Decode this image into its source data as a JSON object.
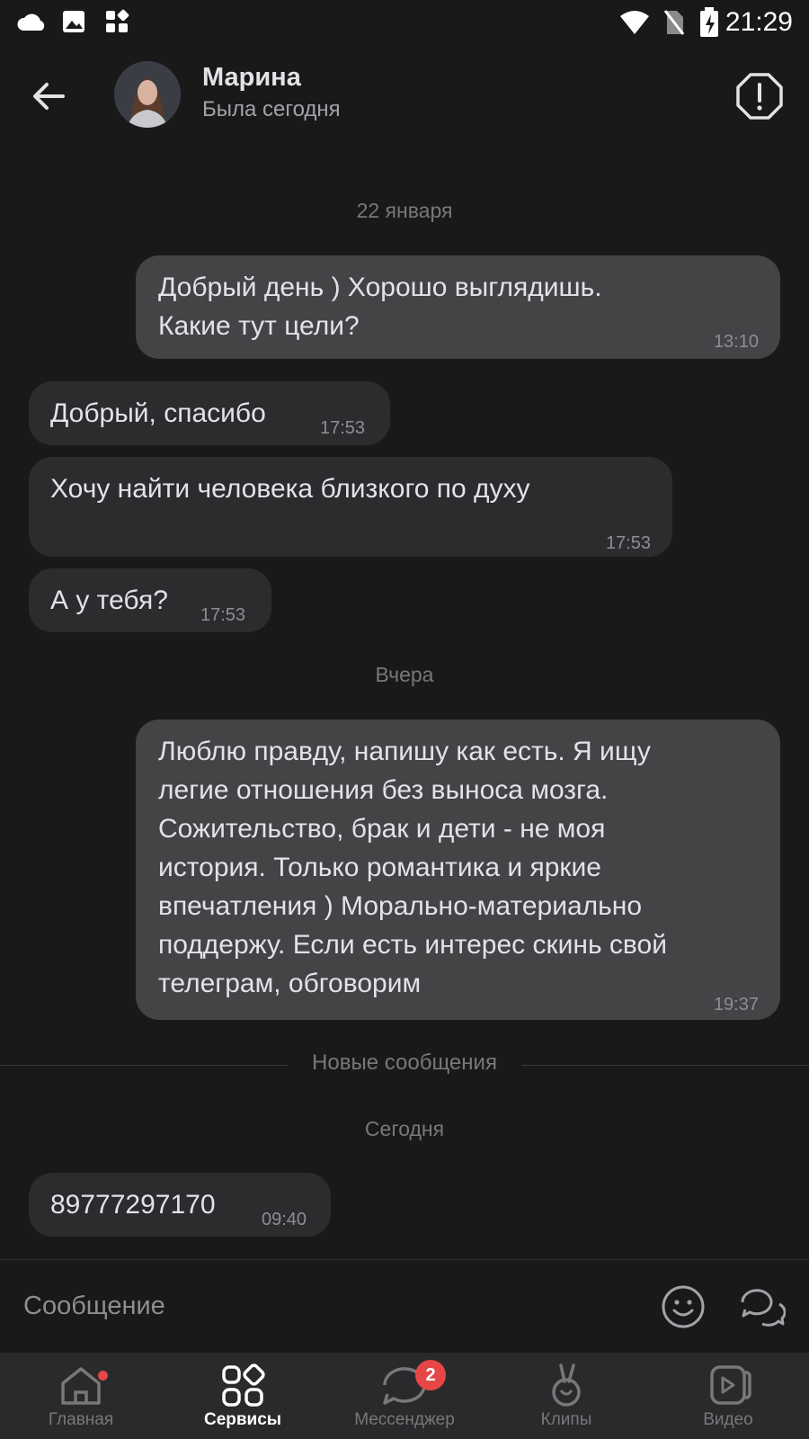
{
  "status_bar": {
    "time": "21:29"
  },
  "header": {
    "contact_name": "Марина",
    "contact_status": "Была сегодня"
  },
  "messages": {
    "date1": "22 января",
    "m1": {
      "lines": [
        "Добрый день ) Хорошо выглядишь.",
        "Какие тут цели?"
      ],
      "time": "13:10"
    },
    "m2": {
      "text": "Добрый, спасибо",
      "time": "17:53"
    },
    "m3": {
      "text": "Хочу найти человека близкого по духу",
      "time": "17:53"
    },
    "m4": {
      "text": "А у тебя?",
      "time": "17:53"
    },
    "date2": "Вчера",
    "m5": {
      "lines": [
        "Люблю правду, напишу как есть. Я ищу",
        "легие отношения без выноса мозга.",
        "Сожительство, брак и дети - не моя",
        "история. Только романтика и яркие",
        "впечатления ) Морально-материально",
        "поддержу. Если есть интерес скинь свой",
        "телеграм, обговорим"
      ],
      "time": "19:37"
    },
    "new_messages_label": "Новые сообщения",
    "date3": "Сегодня",
    "m6": {
      "text": "89777297170",
      "time": "09:40"
    }
  },
  "composer": {
    "placeholder": "Сообщение"
  },
  "bottom_nav": {
    "home": "Главная",
    "services": "Сервисы",
    "messenger": "Мессенджер",
    "messenger_badge": "2",
    "clips": "Клипы",
    "video": "Видео"
  },
  "colors": {
    "background": "#19191a",
    "outgoing_bubble": "#444447",
    "incoming_bubble": "#2c2c2e",
    "badge": "#e64646"
  }
}
